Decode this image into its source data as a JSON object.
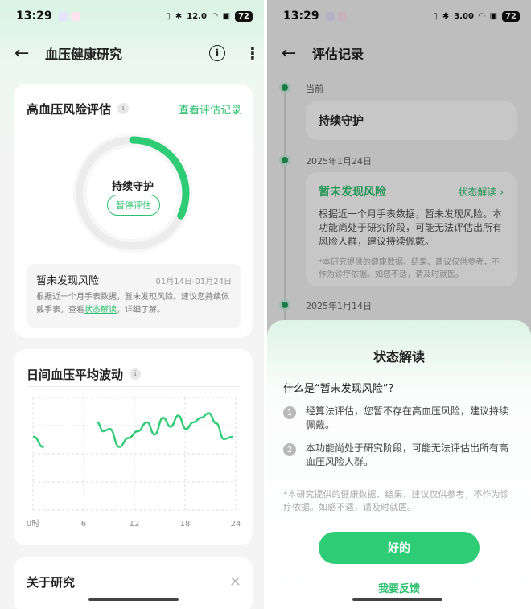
{
  "left": {
    "status_bar": {
      "time": "13:29",
      "battery": "72",
      "net_speed": "12.0"
    },
    "app_bar": {
      "title": "血压健康研究",
      "info_icon": "i",
      "more_icon": "⋮",
      "back_icon": "←"
    },
    "risk_card": {
      "title": "高血压风险评估",
      "link": "查看评估记录",
      "ring_status": "持续守护",
      "pause_button": "暂停评估",
      "ring_progress": 0.32,
      "status_name": "暂未发现风险",
      "status_range": "01月14日-01月24日",
      "desc_prefix": "根据近一个月手表数据，暂未发现风险。建议您持续佩戴手表，查看",
      "desc_link": "状态解读",
      "desc_suffix": "，详细了解。"
    },
    "trend_card": {
      "title": "日间血压平均波动"
    },
    "about_card": {
      "title": "关于研究",
      "close_icon": "✕"
    }
  },
  "chart_data": {
    "type": "line",
    "title": "日间血压平均波动",
    "x_ticks": [
      "0时",
      "6",
      "12",
      "18",
      "24"
    ],
    "xlim": [
      0,
      24
    ],
    "grid": true,
    "series": [
      {
        "values": [
          [
            0.1,
            0.65
          ],
          [
            1.2,
            0.56
          ]
        ]
      },
      {
        "values": [
          [
            7.6,
            0.78
          ],
          [
            8.3,
            0.7
          ],
          [
            9.1,
            0.72
          ],
          [
            10.2,
            0.56
          ],
          [
            11.3,
            0.64
          ],
          [
            12.4,
            0.7
          ],
          [
            13.5,
            0.78
          ],
          [
            14.4,
            0.67
          ],
          [
            15.4,
            0.82
          ],
          [
            16.3,
            0.74
          ],
          [
            17.2,
            0.84
          ],
          [
            18.1,
            0.72
          ],
          [
            19.0,
            0.78
          ],
          [
            19.9,
            0.82
          ],
          [
            20.8,
            0.86
          ],
          [
            21.7,
            0.77
          ],
          [
            22.6,
            0.63
          ],
          [
            23.6,
            0.65
          ]
        ]
      }
    ]
  },
  "right": {
    "status_bar": {
      "time": "13:29",
      "battery": "72",
      "net_speed": "3.00"
    },
    "app_bar": {
      "title": "评估记录",
      "back_icon": "←"
    },
    "timeline": [
      {
        "date": "当前",
        "title": "持续守护"
      },
      {
        "date": "2025年1月24日",
        "title": "暂未发现风险",
        "link": "状态解读 ›",
        "desc": "根据近一个月手表数据，暂未发现风险。本功能尚处于研究阶段，可能无法评估出所有风险人群，建议持续佩戴。",
        "note": "*本研究提供的健康数据、结果、建议仅供参考，不作为诊疗依据。如感不适，请及时就医。"
      },
      {
        "date": "2025年1月14日"
      }
    ],
    "sheet": {
      "title": "状态解读",
      "question": "什么是“暂未发现风险”?",
      "items": [
        {
          "num": "1",
          "text": "经算法评估，您暂不存在高血压风险，建议持续佩戴。"
        },
        {
          "num": "2",
          "text": "本功能尚处于研究阶段，可能无法评估出所有高血压风险人群。"
        }
      ],
      "disclaimer": "*本研究提供的健康数据、结果、建议仅供参考，不作为诊疗依据。如感不适，请及时就医。",
      "ok_button": "好的",
      "feedback": "我要反馈"
    }
  }
}
